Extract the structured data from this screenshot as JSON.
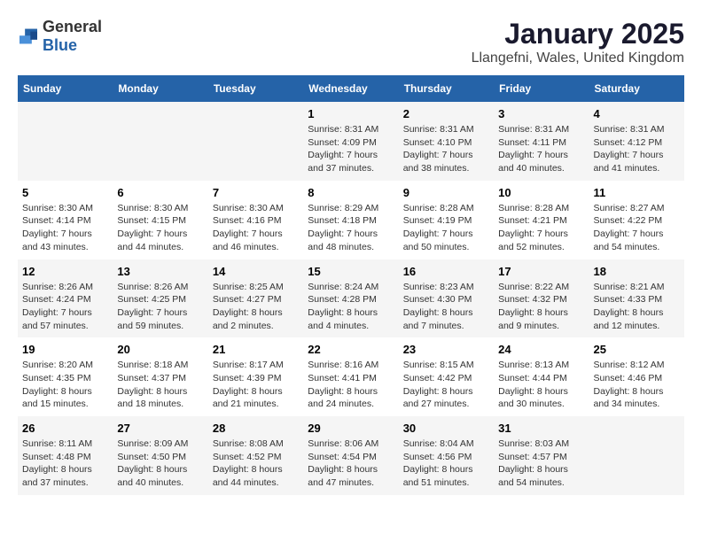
{
  "logo": {
    "general": "General",
    "blue": "Blue"
  },
  "calendar": {
    "title": "January 2025",
    "subtitle": "Llangefni, Wales, United Kingdom"
  },
  "weekdays": [
    "Sunday",
    "Monday",
    "Tuesday",
    "Wednesday",
    "Thursday",
    "Friday",
    "Saturday"
  ],
  "weeks": [
    [
      {
        "day": "",
        "info": ""
      },
      {
        "day": "",
        "info": ""
      },
      {
        "day": "",
        "info": ""
      },
      {
        "day": "1",
        "info": "Sunrise: 8:31 AM\nSunset: 4:09 PM\nDaylight: 7 hours and 37 minutes."
      },
      {
        "day": "2",
        "info": "Sunrise: 8:31 AM\nSunset: 4:10 PM\nDaylight: 7 hours and 38 minutes."
      },
      {
        "day": "3",
        "info": "Sunrise: 8:31 AM\nSunset: 4:11 PM\nDaylight: 7 hours and 40 minutes."
      },
      {
        "day": "4",
        "info": "Sunrise: 8:31 AM\nSunset: 4:12 PM\nDaylight: 7 hours and 41 minutes."
      }
    ],
    [
      {
        "day": "5",
        "info": "Sunrise: 8:30 AM\nSunset: 4:14 PM\nDaylight: 7 hours and 43 minutes."
      },
      {
        "day": "6",
        "info": "Sunrise: 8:30 AM\nSunset: 4:15 PM\nDaylight: 7 hours and 44 minutes."
      },
      {
        "day": "7",
        "info": "Sunrise: 8:30 AM\nSunset: 4:16 PM\nDaylight: 7 hours and 46 minutes."
      },
      {
        "day": "8",
        "info": "Sunrise: 8:29 AM\nSunset: 4:18 PM\nDaylight: 7 hours and 48 minutes."
      },
      {
        "day": "9",
        "info": "Sunrise: 8:28 AM\nSunset: 4:19 PM\nDaylight: 7 hours and 50 minutes."
      },
      {
        "day": "10",
        "info": "Sunrise: 8:28 AM\nSunset: 4:21 PM\nDaylight: 7 hours and 52 minutes."
      },
      {
        "day": "11",
        "info": "Sunrise: 8:27 AM\nSunset: 4:22 PM\nDaylight: 7 hours and 54 minutes."
      }
    ],
    [
      {
        "day": "12",
        "info": "Sunrise: 8:26 AM\nSunset: 4:24 PM\nDaylight: 7 hours and 57 minutes."
      },
      {
        "day": "13",
        "info": "Sunrise: 8:26 AM\nSunset: 4:25 PM\nDaylight: 7 hours and 59 minutes."
      },
      {
        "day": "14",
        "info": "Sunrise: 8:25 AM\nSunset: 4:27 PM\nDaylight: 8 hours and 2 minutes."
      },
      {
        "day": "15",
        "info": "Sunrise: 8:24 AM\nSunset: 4:28 PM\nDaylight: 8 hours and 4 minutes."
      },
      {
        "day": "16",
        "info": "Sunrise: 8:23 AM\nSunset: 4:30 PM\nDaylight: 8 hours and 7 minutes."
      },
      {
        "day": "17",
        "info": "Sunrise: 8:22 AM\nSunset: 4:32 PM\nDaylight: 8 hours and 9 minutes."
      },
      {
        "day": "18",
        "info": "Sunrise: 8:21 AM\nSunset: 4:33 PM\nDaylight: 8 hours and 12 minutes."
      }
    ],
    [
      {
        "day": "19",
        "info": "Sunrise: 8:20 AM\nSunset: 4:35 PM\nDaylight: 8 hours and 15 minutes."
      },
      {
        "day": "20",
        "info": "Sunrise: 8:18 AM\nSunset: 4:37 PM\nDaylight: 8 hours and 18 minutes."
      },
      {
        "day": "21",
        "info": "Sunrise: 8:17 AM\nSunset: 4:39 PM\nDaylight: 8 hours and 21 minutes."
      },
      {
        "day": "22",
        "info": "Sunrise: 8:16 AM\nSunset: 4:41 PM\nDaylight: 8 hours and 24 minutes."
      },
      {
        "day": "23",
        "info": "Sunrise: 8:15 AM\nSunset: 4:42 PM\nDaylight: 8 hours and 27 minutes."
      },
      {
        "day": "24",
        "info": "Sunrise: 8:13 AM\nSunset: 4:44 PM\nDaylight: 8 hours and 30 minutes."
      },
      {
        "day": "25",
        "info": "Sunrise: 8:12 AM\nSunset: 4:46 PM\nDaylight: 8 hours and 34 minutes."
      }
    ],
    [
      {
        "day": "26",
        "info": "Sunrise: 8:11 AM\nSunset: 4:48 PM\nDaylight: 8 hours and 37 minutes."
      },
      {
        "day": "27",
        "info": "Sunrise: 8:09 AM\nSunset: 4:50 PM\nDaylight: 8 hours and 40 minutes."
      },
      {
        "day": "28",
        "info": "Sunrise: 8:08 AM\nSunset: 4:52 PM\nDaylight: 8 hours and 44 minutes."
      },
      {
        "day": "29",
        "info": "Sunrise: 8:06 AM\nSunset: 4:54 PM\nDaylight: 8 hours and 47 minutes."
      },
      {
        "day": "30",
        "info": "Sunrise: 8:04 AM\nSunset: 4:56 PM\nDaylight: 8 hours and 51 minutes."
      },
      {
        "day": "31",
        "info": "Sunrise: 8:03 AM\nSunset: 4:57 PM\nDaylight: 8 hours and 54 minutes."
      },
      {
        "day": "",
        "info": ""
      }
    ]
  ]
}
